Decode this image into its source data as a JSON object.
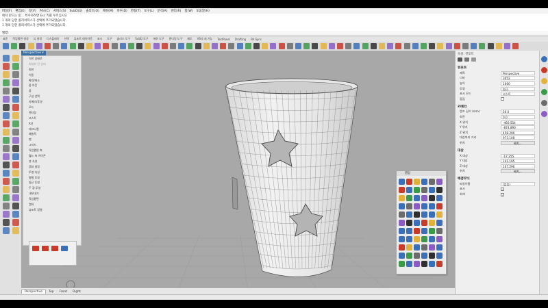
{
  "menubar": {
    "items": [
      "파일(F)",
      "편집(E)",
      "뷰(V)",
      "커브(C)",
      "서피스(S)",
      "SubD(U)",
      "솔리드(O)",
      "메쉬(M)",
      "치수(D)",
      "변형(T)",
      "도구(L)",
      "분석(A)",
      "렌더(R)",
      "창(W)",
      "도움말(H)"
    ]
  },
  "command": {
    "history": [
      "에서 만드는 중... 특수하려면 Esc 키를 누르십시오",
      "1 개의 당한 폴리서피스가 선택에 추가되었습니다.",
      "1 개의 당한 폴리서피스가 선택에 추가되었습니다."
    ],
    "prompt": "명령:"
  },
  "toolbar_tabs": [
    "표준",
    "작업평면 설정",
    "뷰 설정",
    "디스플레이",
    "선택",
    "뷰포트 레이아웃",
    "표시",
    "도구",
    "솔리드 도구",
    "SubD 도구",
    "메쉬 도구",
    "렌더링 도구",
    "제도",
    "V6의 새 기능",
    "TestPanel",
    "Drafting",
    "PA Sync"
  ],
  "viewport": {
    "title": "Perspective ▾",
    "tabs": [
      "Perspective",
      "Top",
      "Front",
      "Right"
    ],
    "active_tab": "Perspective"
  },
  "context_menu": {
    "items": [
      "이전 상태로",
      "최대화 전 상태",
      "회전",
      "이동",
      "확대/축소",
      "줌 아웃",
      "줌",
      "구성 선택",
      "카메라/투영",
      "모드",
      "렌더링",
      "고스트",
      "X선",
      "테크니컬",
      "예술적",
      "펜",
      "그리드",
      "작업평면 축",
      "월드 축 아이콘",
      "뷰 속성",
      "캡처 설정",
      "투영 속성",
      "평행 투영",
      "원근 투영",
      "두 점 투영",
      "내보내기",
      "작업평면",
      "캡처",
      "뷰포트 정렬"
    ]
  },
  "properties_panel": {
    "header": "속성: 뷰포트",
    "viewport_section": "뷰포트",
    "viewport_rows": [
      {
        "label": "제목",
        "value": "Perspective"
      },
      {
        "label": "너비",
        "value": "3052"
      },
      {
        "label": "높이",
        "value": "1660"
      },
      {
        "label": "투영",
        "value": "원근"
      },
      {
        "label": "표시 모드",
        "value": "고스트"
      }
    ],
    "locked_label": "잠김",
    "camera_section": "카메라",
    "camera_rows": [
      {
        "label": "렌즈 길이 (mm)",
        "value": "50.0"
      },
      {
        "label": "회전",
        "value": "0.0"
      },
      {
        "label": "X 위치",
        "value": "-460.554"
      },
      {
        "label": "Y 위치",
        "value": "-874.890"
      },
      {
        "label": "Z 위치",
        "value": "458.290"
      },
      {
        "label": "대상까지 거리",
        "value": "973.108"
      }
    ],
    "camera_place_label": "위치",
    "camera_place_button": "배치...",
    "target_section": "대상",
    "target_rows": [
      {
        "label": "X 대상",
        "value": "-17.255"
      },
      {
        "label": "Y 대상",
        "value": "141.195"
      },
      {
        "label": "Z 대상",
        "value": "107.296"
      }
    ],
    "target_place_label": "위치",
    "target_place_button": "배치...",
    "wallpaper_section": "배경무늬",
    "wallpaper_rows": [
      {
        "label": "파일이름",
        "value": "(없음)"
      }
    ],
    "show_label": "표시",
    "gray_label": "회색"
  },
  "floating_toolbar": {
    "title": "탭팅"
  },
  "colors": {
    "viewport_bg": "#a8a8a8",
    "accent": "#3a6ea5",
    "icon_blue": "#3b6fb8",
    "icon_red": "#c83a2a",
    "icon_yellow": "#e2b13c"
  }
}
